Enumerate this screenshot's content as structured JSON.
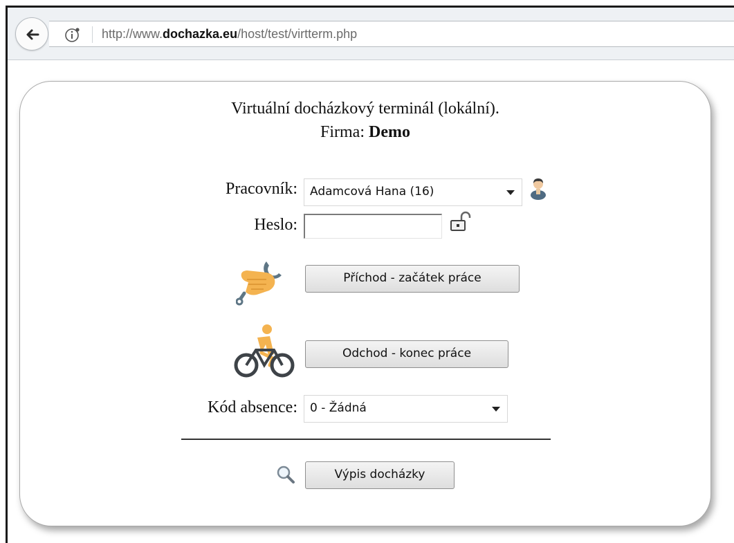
{
  "browser": {
    "url_prefix": "http://www.",
    "url_domain": "dochazka.eu",
    "url_path": "/host/test/virtterm.php"
  },
  "terminal": {
    "title": "Virtuální docházkový terminál (lokální).",
    "firm_label": "Firma:",
    "firm_name": "Demo",
    "employee_label": "Pracovník:",
    "employee_value": "Adamcová Hana (16)",
    "password_label": "Heslo:",
    "password_value": "",
    "arrival_button": "Příchod - začátek práce",
    "departure_button": "Odchod - konec práce",
    "absence_label": "Kód absence:",
    "absence_value": "0 - Žádná",
    "report_button": "Výpis docházky"
  },
  "icons": {
    "back": "back-arrow-icon",
    "info": "info-icon",
    "employee": "user-icon",
    "password": "unlocked-padlock-icon",
    "arrival": "hand-wrench-icon",
    "departure": "cyclist-icon",
    "report": "magnifier-icon"
  },
  "colors": {
    "icon_orange": "#f4b350",
    "icon_steel": "#5e7685",
    "toolbar_bg": "#eef1f4"
  }
}
